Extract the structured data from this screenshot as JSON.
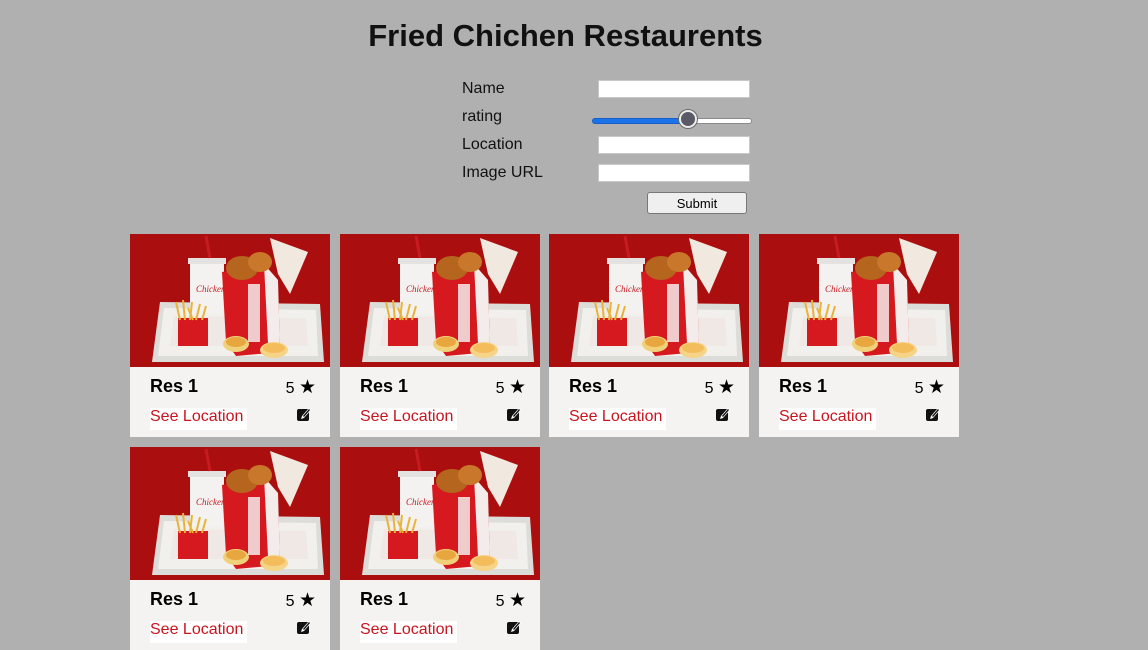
{
  "title": "Fried Chichen Restaurents",
  "form": {
    "name_label": "Name",
    "name_value": "",
    "rating_label": "rating",
    "rating_level": 0.6,
    "location_label": "Location",
    "location_value": "",
    "image_label": "Image URL",
    "image_value": "",
    "submit_label": "Submit"
  },
  "colors": {
    "background": "#b0b0b0",
    "card": "#f5f3f2",
    "link": "#c8141e",
    "slider_fill": "#1a73e8"
  },
  "cards": [
    {
      "name": "Res 1",
      "rating": "5",
      "star": "★",
      "link": "See Location",
      "icon": "edit-icon"
    },
    {
      "name": "Res 1",
      "rating": "5",
      "star": "★",
      "link": "See Location",
      "icon": "edit-icon"
    },
    {
      "name": "Res 1",
      "rating": "5",
      "star": "★",
      "link": "See Location",
      "icon": "edit-icon"
    },
    {
      "name": "Res 1",
      "rating": "5",
      "star": "★",
      "link": "See Location",
      "icon": "edit-icon"
    },
    {
      "name": "Res 1",
      "rating": "5",
      "star": "★",
      "link": "See Location",
      "icon": "edit-icon"
    },
    {
      "name": "Res 1",
      "rating": "5",
      "star": "★",
      "link": "See Location",
      "icon": "edit-icon"
    }
  ]
}
